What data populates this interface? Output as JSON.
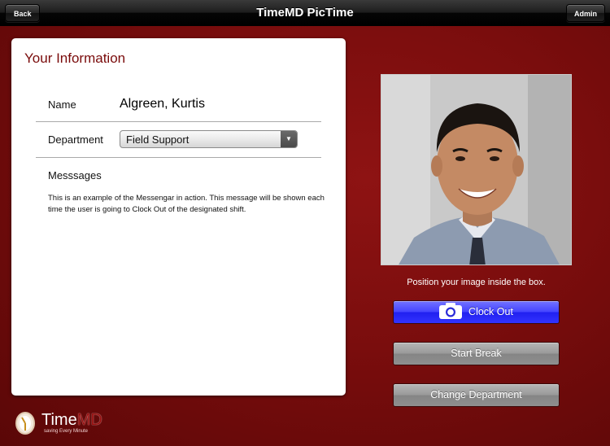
{
  "navbar": {
    "title": "TimeMD PicTime",
    "back_label": "Back",
    "admin_label": "Admin"
  },
  "info_panel": {
    "title": "Your Information",
    "name_label": "Name",
    "name_value": "Algreen, Kurtis",
    "department_label": "Department",
    "department_value": "Field Support",
    "messages_label": "Messsages",
    "message_text": "This is an example of the Messengar in action. This message will be shown each time the user is going to Clock Out of the designated shift."
  },
  "camera": {
    "hint": "Position your image inside the box.",
    "clock_out_label": "Clock Out",
    "start_break_label": "Start Break",
    "change_department_label": "Change Department"
  },
  "branding": {
    "logo_time": "Time",
    "logo_md": "MD",
    "tagline": "saving Every Minute"
  },
  "colors": {
    "background": "#7a0d0d",
    "title_accent": "#7a0b0b",
    "clock_out_button": "#3a3aff",
    "secondary_button": "#999999"
  }
}
